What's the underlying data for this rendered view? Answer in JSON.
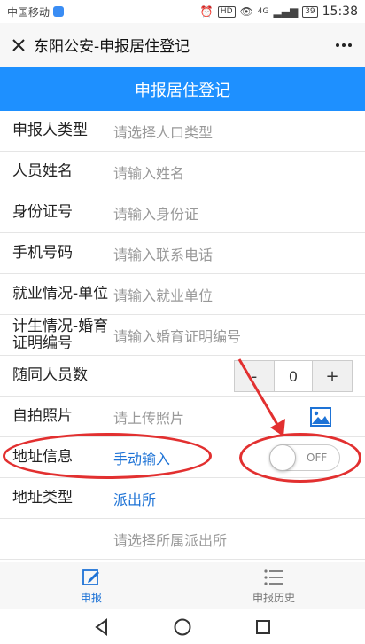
{
  "status_bar": {
    "carrier": "中国移动",
    "hd": "HD",
    "network": "4G",
    "battery": "39",
    "time": "15:38"
  },
  "title_bar": {
    "title": "东阳公安-申报居住登记"
  },
  "header": {
    "title": "申报居住登记"
  },
  "form": {
    "rows": [
      {
        "label": "申报人类型",
        "value": "请选择人口类型"
      },
      {
        "label": "人员姓名",
        "value": "请输入姓名"
      },
      {
        "label": "身份证号",
        "value": "请输入身份证"
      },
      {
        "label": "手机号码",
        "value": "请输入联系电话"
      },
      {
        "label": "就业情况-单位",
        "value": "请输入就业单位"
      },
      {
        "label": "计生情况-婚育证明编号",
        "value": "请输入婚育证明编号"
      },
      {
        "label": "随同人员数",
        "stepper": {
          "minus": "-",
          "value": "0",
          "plus": "+"
        }
      },
      {
        "label": "自拍照片",
        "value": "请上传照片"
      },
      {
        "label": "地址信息",
        "value": "手动输入",
        "toggle": "OFF"
      },
      {
        "label": "地址类型",
        "value": "派出所"
      },
      {
        "label": "",
        "value": "请选择所属派出所"
      }
    ]
  },
  "tabs": [
    {
      "label": "申报",
      "icon": "edit-icon",
      "active": true
    },
    {
      "label": "申报历史",
      "icon": "list-icon",
      "active": false
    }
  ],
  "colors": {
    "primary": "#1e90ff",
    "link": "#1e73d6",
    "annotation": "#e23030"
  }
}
